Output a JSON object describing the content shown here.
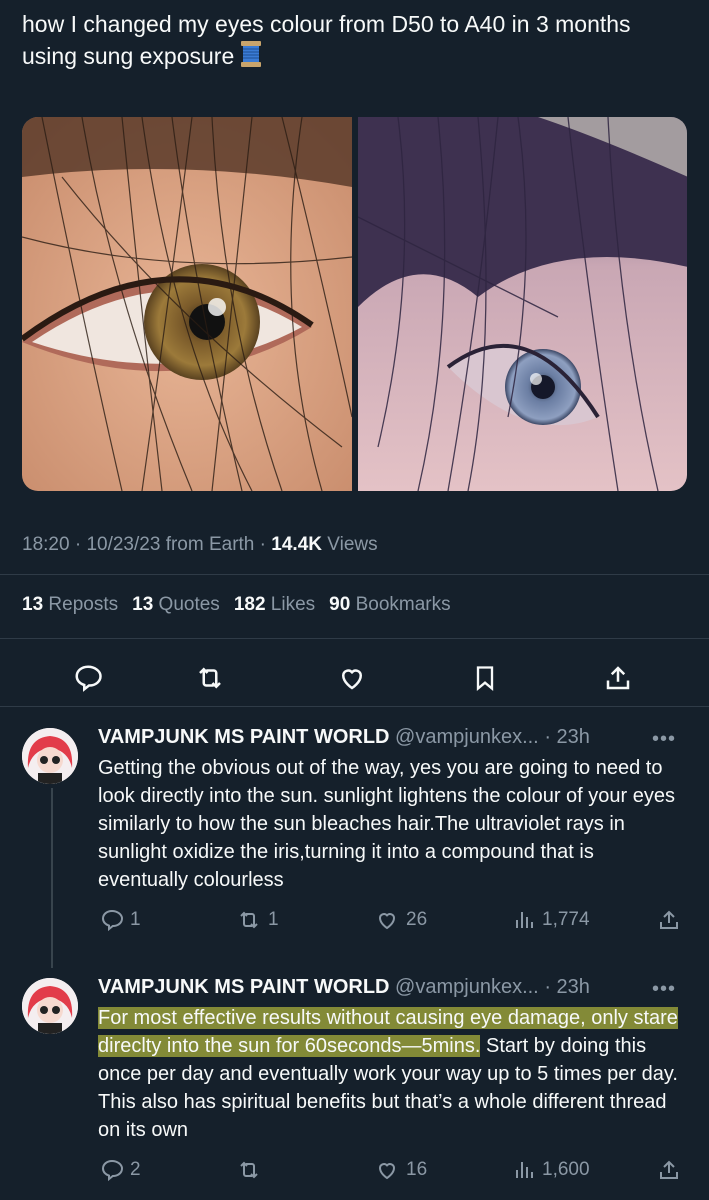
{
  "tweet": {
    "text": "how I changed my eyes colour from D50 to A40 in 3 months using sung exposure",
    "emoji_icon": "spool-of-thread-icon"
  },
  "meta": {
    "time": "18:20",
    "date": "10/23/23",
    "source": "from Earth",
    "views_count": "14.4K",
    "views_label": "Views"
  },
  "stats": {
    "reposts_count": "13",
    "reposts_label": "Reposts",
    "quotes_count": "13",
    "quotes_label": "Quotes",
    "likes_count": "182",
    "likes_label": "Likes",
    "bookmarks_count": "90",
    "bookmarks_label": "Bookmarks"
  },
  "replies": [
    {
      "name": "VAMPJUNK MS PAINT WORLD",
      "handle": "@vampjunkex...",
      "time": "· 23h",
      "more": "•••",
      "text": "Getting the obvious out of the way, yes you are going to need to look directly into the sun. sunlight lightens the colour of your eyes similarly to how the sun bleaches hair.The ultraviolet rays in sunlight oxidize the iris,turning it into a compound that is eventually colourless",
      "reply_count": "1",
      "repost_count": "1",
      "like_count": "26",
      "view_count": "1,774"
    },
    {
      "name": "VAMPJUNK MS PAINT WORLD",
      "handle": "@vampjunkex...",
      "time": "· 23h",
      "more": "•••",
      "text_highlighted": "For most effective results without causing eye damage, only stare direclty into the sun for 60seconds—5mins.",
      "text_rest": "Start by doing this once per day and eventually work your way up to 5 times per day. This also has spiritual benefits but that’s a whole different thread on its own",
      "reply_count": "2",
      "repost_count": "",
      "like_count": "16",
      "view_count": "1,600"
    }
  ],
  "colors": {
    "background": "#15202b",
    "text": "#f7f9f9",
    "secondary": "#8b98a5",
    "highlight": "#dee242"
  }
}
